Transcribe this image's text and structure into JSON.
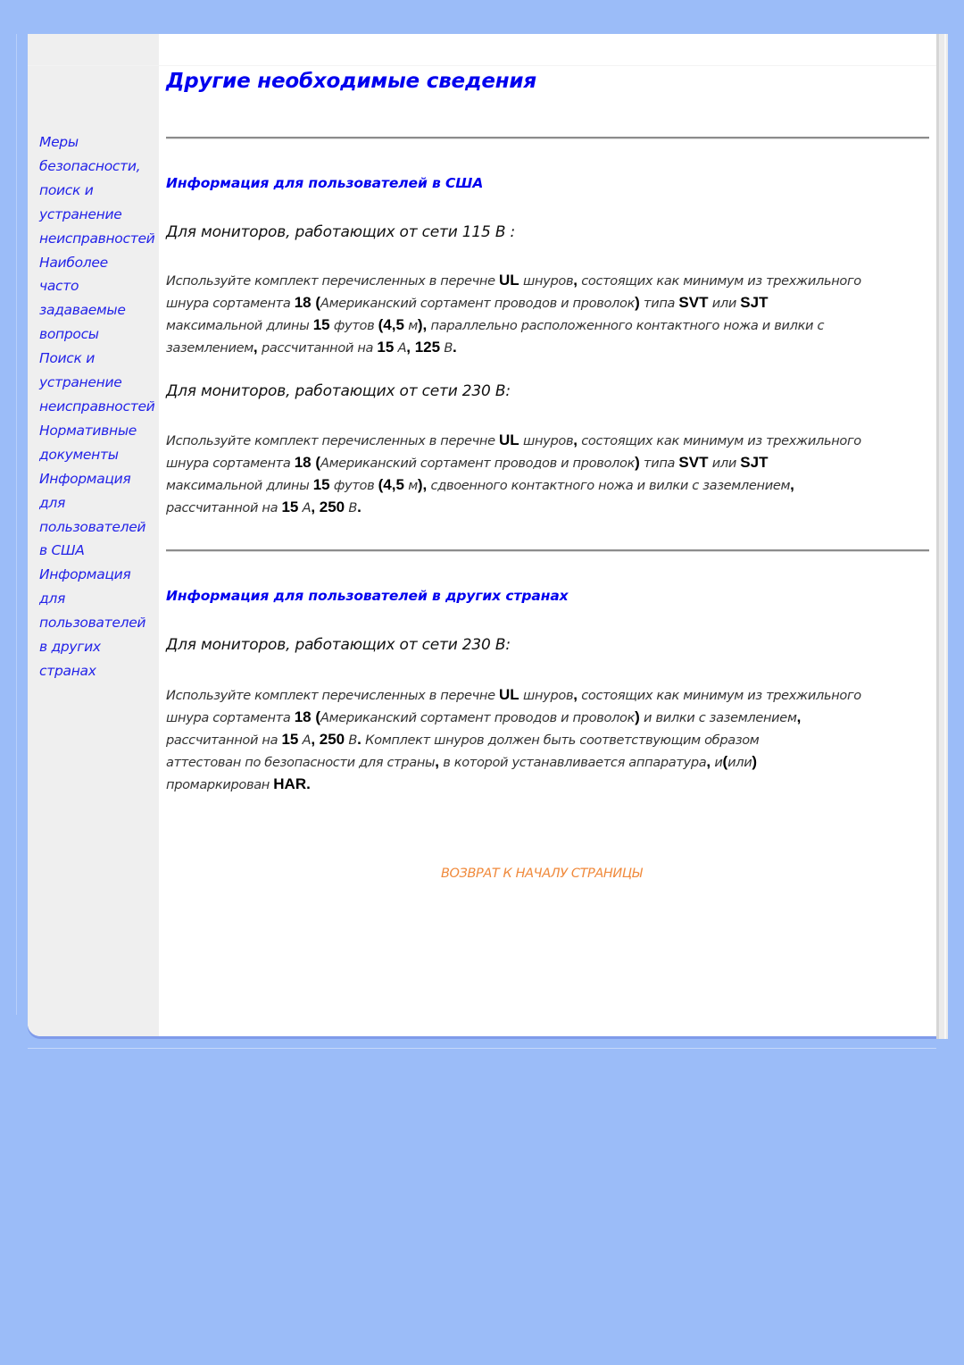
{
  "page": {
    "title": "Другие необходимые сведения"
  },
  "sidebar": {
    "items": [
      {
        "label_lines": [
          "Меры",
          "безопасности,",
          "поиск и",
          "устранение",
          "неисправностей"
        ]
      },
      {
        "label_lines": [
          "Наиболее",
          "часто",
          "задаваемые",
          "вопросы"
        ]
      },
      {
        "label_lines": [
          "Поиск и",
          "устранение",
          "неисправностей"
        ]
      },
      {
        "label_lines": [
          "Нормативные",
          "документы"
        ]
      },
      {
        "label_lines": [
          "Информация",
          "для",
          "пользователей",
          "в США"
        ]
      },
      {
        "label_lines": [
          "Информация",
          "для",
          "пользователей",
          "в других",
          "странах"
        ]
      }
    ]
  },
  "sections": [
    {
      "heading": "Информация для пользователей в США",
      "blocks": [
        {
          "subheading": "Для мониторов, работающих от сети 115 В :",
          "lines": [
            [
              {
                "t": "Используйте комплект перечисленных в перечне "
              },
              {
                "b": "UL"
              },
              {
                "t": " шнуров"
              },
              {
                "b": ","
              },
              {
                "t": " состоящих как минимум из трехжильного"
              }
            ],
            [
              {
                "t": "шнура сортамента "
              },
              {
                "b": "18 ("
              },
              {
                "t": "Американский сортамент проводов и проволок"
              },
              {
                "b": ")"
              },
              {
                "t": " типа "
              },
              {
                "b": "SVT"
              },
              {
                "t": " или "
              },
              {
                "b": "SJT"
              }
            ],
            [
              {
                "t": "максимальной длины "
              },
              {
                "b": "15"
              },
              {
                "t": " футов "
              },
              {
                "b": "(4,5"
              },
              {
                "t": " м"
              },
              {
                "b": "),"
              },
              {
                "t": " параллельно расположенного контактного ножа и вилки с"
              }
            ],
            [
              {
                "t": "заземлением"
              },
              {
                "b": ","
              },
              {
                "t": " рассчитанной на "
              },
              {
                "b": "15"
              },
              {
                "t": " А"
              },
              {
                "b": ", 125"
              },
              {
                "t": " В"
              },
              {
                "b": "."
              }
            ]
          ]
        },
        {
          "subheading": "Для мониторов, работающих от сети 230 В:",
          "lines": [
            [
              {
                "t": "Используйте комплект перечисленных в перечне "
              },
              {
                "b": "UL"
              },
              {
                "t": " шнуров"
              },
              {
                "b": ","
              },
              {
                "t": " состоящих как минимум из трехжильного"
              }
            ],
            [
              {
                "t": "шнура сортамента "
              },
              {
                "b": "18 ("
              },
              {
                "t": "Американский сортамент проводов и проволок"
              },
              {
                "b": ")"
              },
              {
                "t": " типа "
              },
              {
                "b": "SVT"
              },
              {
                "t": " или "
              },
              {
                "b": "SJT"
              }
            ],
            [
              {
                "t": "максимальной длины "
              },
              {
                "b": "15"
              },
              {
                "t": " футов "
              },
              {
                "b": "(4,5"
              },
              {
                "t": " м"
              },
              {
                "b": "),"
              },
              {
                "t": " сдвоенного контактного ножа и вилки с заземлением"
              },
              {
                "b": ","
              }
            ],
            [
              {
                "t": "рассчитанной на "
              },
              {
                "b": "15"
              },
              {
                "t": " А"
              },
              {
                "b": ", 250"
              },
              {
                "t": " В"
              },
              {
                "b": "."
              }
            ]
          ]
        }
      ]
    },
    {
      "heading": "Информация для пользователей в других странах",
      "blocks": [
        {
          "subheading": "Для мониторов, работающих от сети 230 В:",
          "lines": [
            [
              {
                "t": "Используйте комплект перечисленных в перечне "
              },
              {
                "b": "UL"
              },
              {
                "t": " шнуров"
              },
              {
                "b": ","
              },
              {
                "t": " состоящих как минимум из трехжильного"
              }
            ],
            [
              {
                "t": "шнура сортамента "
              },
              {
                "b": "18 ("
              },
              {
                "t": "Американский сортамент проводов и проволок"
              },
              {
                "b": ")"
              },
              {
                "t": " и вилки с заземлением"
              },
              {
                "b": ","
              }
            ],
            [
              {
                "t": "рассчитанной на "
              },
              {
                "b": "15"
              },
              {
                "t": " А"
              },
              {
                "b": ", 250"
              },
              {
                "t": " В"
              },
              {
                "b": "."
              },
              {
                "t": " Комплект шнуров должен быть соответствующим образом"
              }
            ],
            [
              {
                "t": "аттестован по безопасности для страны"
              },
              {
                "b": ","
              },
              {
                "t": " в которой устанавливается аппаратура"
              },
              {
                "b": ","
              },
              {
                "t": " и"
              },
              {
                "b": "("
              },
              {
                "t": "или"
              },
              {
                "b": ")"
              }
            ],
            [
              {
                "t": "промаркирован "
              },
              {
                "b": "HAR."
              }
            ]
          ]
        }
      ]
    }
  ],
  "footer": {
    "back_to_top": "ВОЗВРАТ К НАЧАЛУ СТРАНИЦЫ"
  },
  "colors": {
    "background": "#9bbcf8",
    "link": "#0000ee",
    "nav_link": "#2323e8",
    "back_to_top": "#f08a3c",
    "sidebar_bg": "#efefef"
  }
}
